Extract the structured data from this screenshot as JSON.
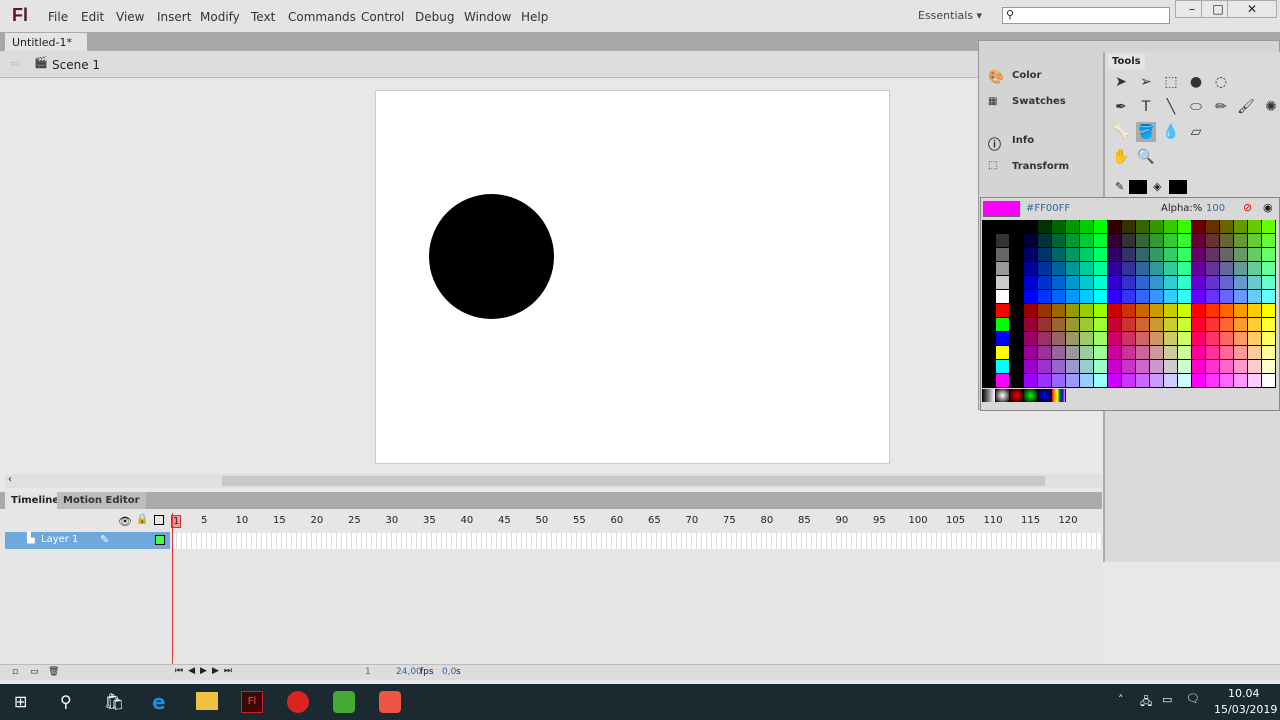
{
  "app": {
    "logo": "Fl",
    "menu": [
      "File",
      "Edit",
      "View",
      "Insert",
      "Modify",
      "Text",
      "Commands",
      "Control",
      "Debug",
      "Window",
      "Help"
    ],
    "workspace": "Essentials",
    "search_placeholder": ""
  },
  "document": {
    "tab": "Untitled-1*",
    "scene": "Scene 1"
  },
  "stage": {
    "shape": "circle",
    "shape_color": "#000000",
    "background": "#FFFFFF"
  },
  "panels": {
    "items": [
      "Color",
      "Swatches",
      "Info",
      "Transform"
    ],
    "tools_title": "Tools"
  },
  "color_picker": {
    "hex": "#FF00FF",
    "alpha_label": "Alpha:%",
    "alpha": "100",
    "preview_color": "#FF00FF"
  },
  "timeline": {
    "tabs": [
      "Timeline",
      "Motion Editor"
    ],
    "layer": "Layer 1",
    "ruler": [
      "1",
      "5",
      "10",
      "15",
      "20",
      "25",
      "30",
      "35",
      "40",
      "45",
      "50",
      "55",
      "60",
      "65",
      "70",
      "75",
      "80",
      "85",
      "90",
      "95",
      "100",
      "105",
      "110",
      "115",
      "120"
    ],
    "current_frame": "1",
    "fps": "24,00",
    "fps_unit": "fps",
    "time": "0,0",
    "time_unit": "s"
  },
  "taskbar": {
    "time": "10.04",
    "date": "15/03/2019",
    "apps": [
      "Start",
      "Search",
      "Store",
      "Edge",
      "File Explorer",
      "Flash",
      "App",
      "Camtasia",
      "Camtasia Recorder"
    ]
  }
}
